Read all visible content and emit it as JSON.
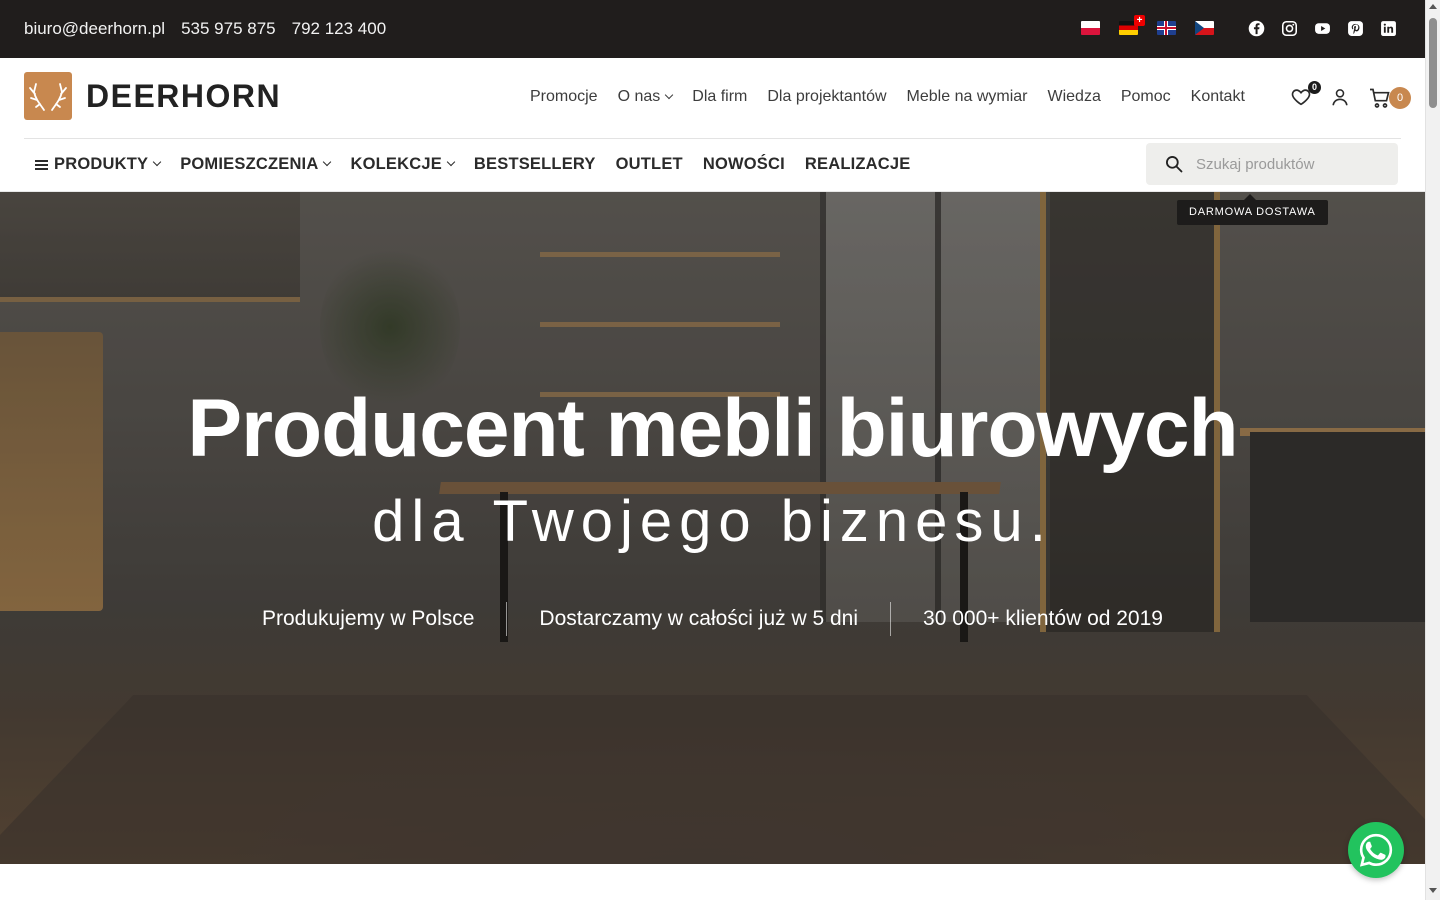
{
  "topbar": {
    "email": "biuro@deerhorn.pl",
    "phone1": "535 975 875",
    "phone2": "792 123 400",
    "languages": [
      "pl-flag",
      "de-ch-flag",
      "uk-flag",
      "cz-flag"
    ],
    "socials": [
      "facebook-icon",
      "instagram-icon",
      "youtube-icon",
      "pinterest-icon",
      "linkedin-icon"
    ]
  },
  "header": {
    "logo_text": "DEERHORN",
    "nav": [
      {
        "label": "Promocje"
      },
      {
        "label": "O nas"
      },
      {
        "label": "Dla firm"
      },
      {
        "label": "Dla projektantów"
      },
      {
        "label": "Meble na wymiar"
      },
      {
        "label": "Wiedza"
      },
      {
        "label": "Pomoc"
      },
      {
        "label": "Kontakt"
      }
    ],
    "wishlist_count": "0",
    "cart_count": "0"
  },
  "catnav": {
    "items": [
      {
        "label": "PRODUKTY"
      },
      {
        "label": "POMIESZCZENIA"
      },
      {
        "label": "KOLEKCJE"
      },
      {
        "label": "BESTSELLERY"
      },
      {
        "label": "OUTLET"
      },
      {
        "label": "NOWOŚCI"
      },
      {
        "label": "REALIZACJE"
      }
    ],
    "search_placeholder": "Szukaj produktów"
  },
  "hero": {
    "title": "Producent mebli biurowych",
    "subtitle": "dla Twojego biznesu.",
    "usps": [
      "Produkujemy w Polsce",
      "Dostarczamy w całości już w 5 dni",
      "30 000+ klientów od 2019"
    ]
  },
  "tooltip": "DARMOWA DOSTAWA",
  "colors": {
    "accent": "#c8884f",
    "topbar": "#201d1c",
    "whatsapp": "#22c35e"
  }
}
